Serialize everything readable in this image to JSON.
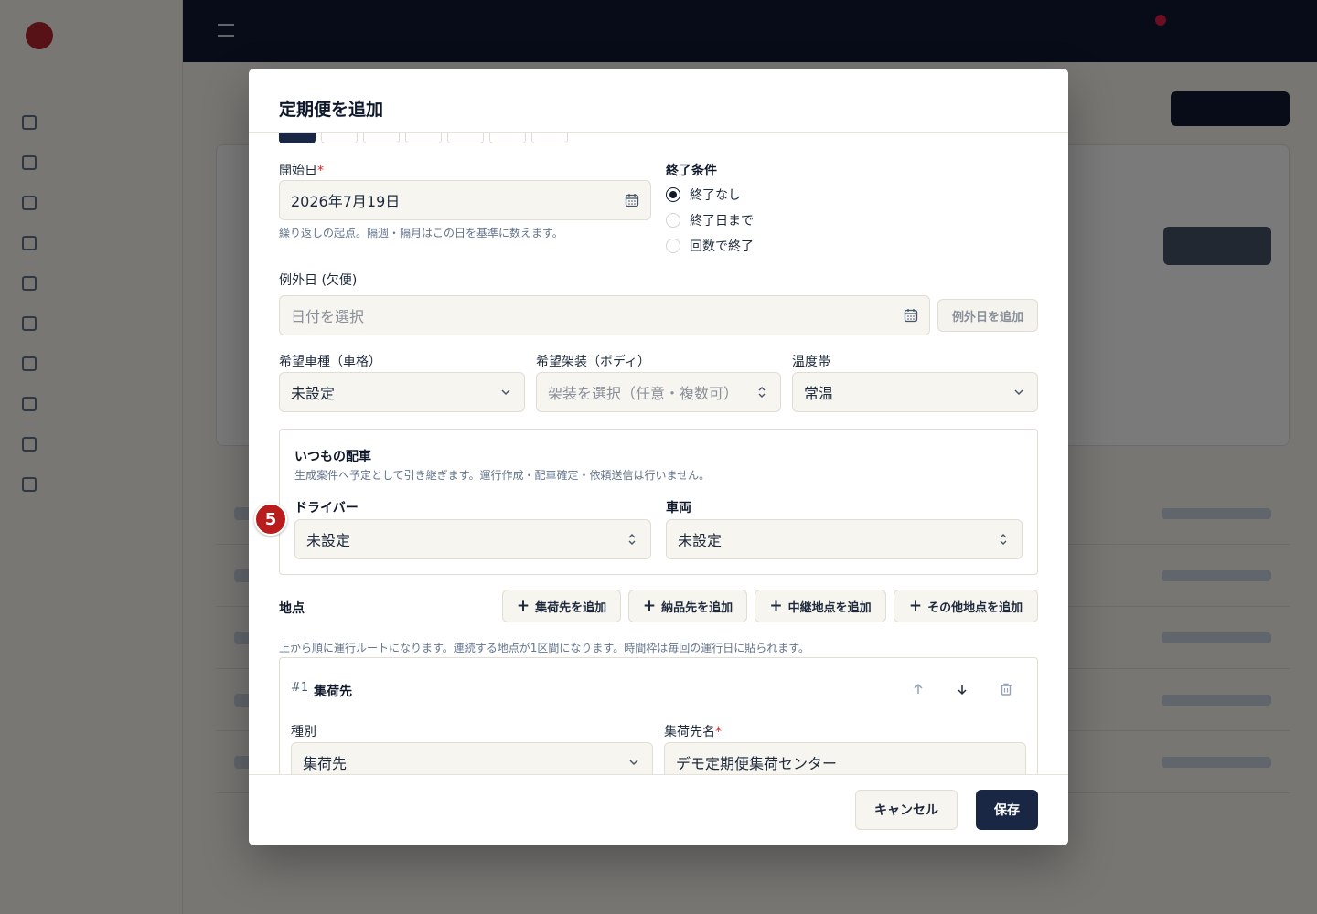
{
  "dialog": {
    "title": "定期便を追加"
  },
  "start_date": {
    "label": "開始日",
    "required_mark": "*",
    "value": "2026年7月19日",
    "hint": "繰り返しの起点。隔週・隔月はこの日を基準に数えます。"
  },
  "end_condition": {
    "label": "終了条件",
    "options": [
      "終了なし",
      "終了日まで",
      "回数で終了"
    ],
    "selected": "終了なし"
  },
  "exception_dates": {
    "label": "例外日 (欠便)",
    "placeholder": "日付を選択",
    "add_button": "例外日を追加"
  },
  "vehicle_type": {
    "label": "希望車種（車格）",
    "value": "未設定"
  },
  "body_type": {
    "label": "希望架装（ボディ）",
    "placeholder": "架装を選択（任意・複数可）"
  },
  "temperature": {
    "label": "温度帯",
    "value": "常温"
  },
  "usual_dispatch": {
    "step_badge": "5",
    "title": "いつもの配車",
    "hint": "生成案件へ予定として引き継ぎます。運行作成・配車確定・依頼送信は行いません。",
    "driver_label": "ドライバー",
    "driver_value": "未設定",
    "vehicle_label": "車両",
    "vehicle_value": "未設定"
  },
  "locations": {
    "label": "地点",
    "add_pickup": "集荷先を追加",
    "add_delivery": "納品先を追加",
    "add_relay": "中継地点を追加",
    "add_other": "その他地点を追加",
    "hint": "上から順に運行ルートになります。連続する地点が1区間になります。時間枠は毎回の運行日に貼られます。",
    "items": [
      {
        "index": "#1",
        "type_title": "集荷先",
        "kind_label": "種別",
        "kind_value": "集荷先",
        "name_label": "集荷先名",
        "required_mark": "*",
        "name_value": "デモ定期便集荷センター"
      }
    ]
  },
  "footer": {
    "cancel": "キャンセル",
    "save": "保存"
  }
}
